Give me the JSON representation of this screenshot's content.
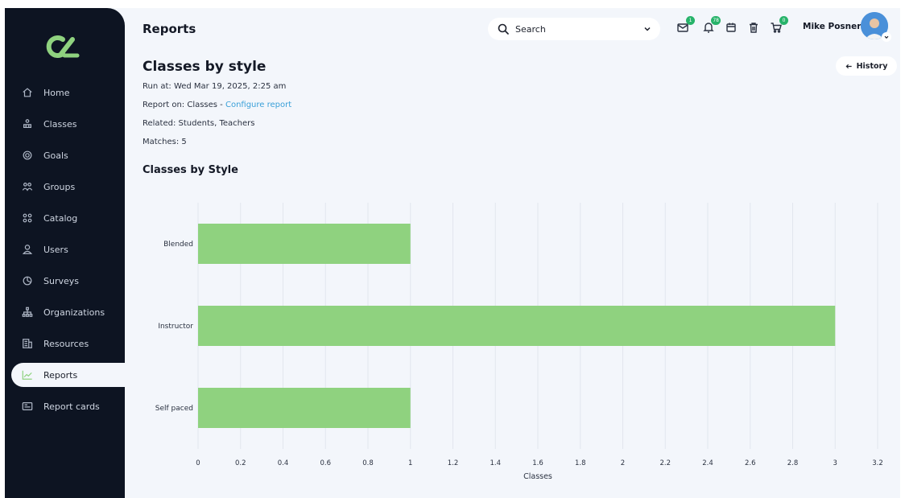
{
  "header": {
    "title": "Reports",
    "search_placeholder": "Search",
    "user_name": "Mike Posner",
    "badges": {
      "messages": "1",
      "notifications": "78",
      "cart": "0"
    }
  },
  "sidebar": {
    "items": [
      {
        "label": "Home",
        "icon": "home-icon",
        "active": false
      },
      {
        "label": "Classes",
        "icon": "classes-icon",
        "active": false
      },
      {
        "label": "Goals",
        "icon": "goals-icon",
        "active": false
      },
      {
        "label": "Groups",
        "icon": "groups-icon",
        "active": false
      },
      {
        "label": "Catalog",
        "icon": "catalog-icon",
        "active": false
      },
      {
        "label": "Users",
        "icon": "users-icon",
        "active": false
      },
      {
        "label": "Surveys",
        "icon": "surveys-icon",
        "active": false
      },
      {
        "label": "Organizations",
        "icon": "organizations-icon",
        "active": false
      },
      {
        "label": "Resources",
        "icon": "resources-icon",
        "active": false
      },
      {
        "label": "Reports",
        "icon": "reports-icon",
        "active": true
      },
      {
        "label": "Report cards",
        "icon": "report-cards-icon",
        "active": false
      }
    ]
  },
  "report": {
    "title": "Classes by style",
    "run_at": "Run at: Wed Mar 19, 2025, 2:25 am",
    "report_on_prefix": "Report on: Classes - ",
    "configure_link": "Configure report",
    "related": "Related: Students, Teachers",
    "matches": "Matches: 5",
    "history_label": "History"
  },
  "colors": {
    "accent": "#8fd27f",
    "sidebar_bg": "#0d1422",
    "link": "#3aa0d8",
    "badge": "#27b36a"
  },
  "chart_data": {
    "type": "bar",
    "orientation": "horizontal",
    "title": "Classes by Style",
    "categories": [
      "Blended",
      "Instructor",
      "Self paced"
    ],
    "values": [
      1,
      3,
      1
    ],
    "xlabel": "Classes",
    "xlim": [
      0,
      3.2
    ],
    "xticks": [
      "0",
      "0.2",
      "0.4",
      "0.6",
      "0.8",
      "1",
      "1.2",
      "1.4",
      "1.6",
      "1.8",
      "2",
      "2.2",
      "2.4",
      "2.6",
      "2.8",
      "3",
      "3.2"
    ],
    "grid": true,
    "bar_color": "#8fd27f"
  }
}
